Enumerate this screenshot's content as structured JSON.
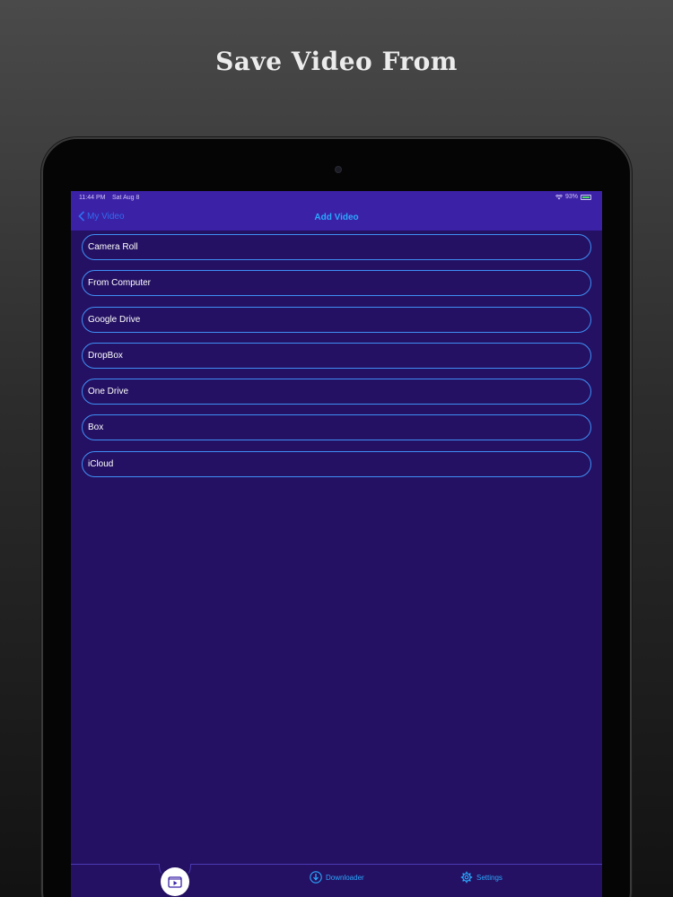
{
  "promo": {
    "title": "Save Video From"
  },
  "status_bar": {
    "time": "11:44 PM",
    "date": "Sat Aug 8",
    "battery": "93%"
  },
  "nav": {
    "back_label": "My Video",
    "title": "Add Video"
  },
  "sources": [
    {
      "label": "Camera Roll"
    },
    {
      "label": "From Computer"
    },
    {
      "label": "Google Drive"
    },
    {
      "label": "DropBox"
    },
    {
      "label": "One Drive"
    },
    {
      "label": "Box"
    },
    {
      "label": "iCloud"
    }
  ],
  "tab_bar": {
    "home_icon": "video-folder-icon",
    "downloader_label": "Downloader",
    "downloader_icon": "download-icon",
    "settings_label": "Settings",
    "settings_icon": "gear-icon"
  },
  "colors": {
    "screen_bg": "#241163",
    "nav_bg": "#3b21a6",
    "accent": "#2aa9ff",
    "item_border": "#3f8ff5"
  }
}
